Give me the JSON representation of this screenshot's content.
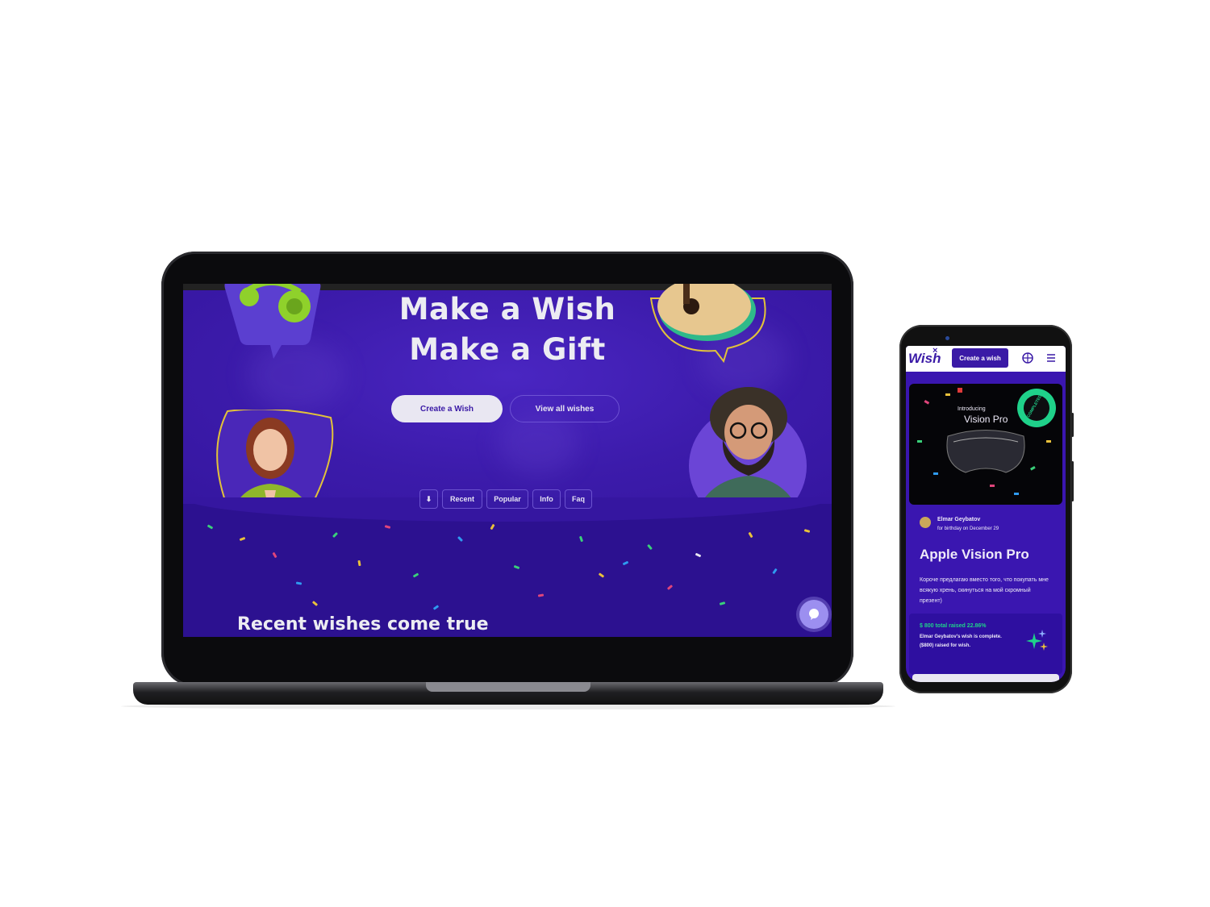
{
  "laptop": {
    "hero": {
      "title_line1": "Make a Wish",
      "title_line2": "Make a Gift",
      "create_button": "Create a Wish",
      "view_button": "View all wishes"
    },
    "nav": {
      "arrow": "⬇",
      "items": [
        "Recent",
        "Popular",
        "Info",
        "Faq"
      ]
    },
    "section_title": "Recent wishes come true",
    "chat_icon": "chat-icon",
    "colors": {
      "background": "#3a1aa6",
      "accent": "#e9e7f2",
      "lime": "#9acd32"
    }
  },
  "phone": {
    "logo": "Wish",
    "logo_mark": "×",
    "create_button": "Create a wish",
    "card": {
      "introducing": "Introducing",
      "product": "Vision Pro",
      "badge": "COMPLETED"
    },
    "author": "Elmar Geybatov",
    "occasion": "for birthday on December 29",
    "title": "Apple Vision Pro",
    "description": "Короче предлагаю вместо того, что покупать мне всякую хрень, скинуться на мой скромный презент)",
    "raised": "$ 800 total raised 22.86%",
    "raised_note": "Elmar Geybatov's wish is complete. ($800) raised for wish."
  }
}
